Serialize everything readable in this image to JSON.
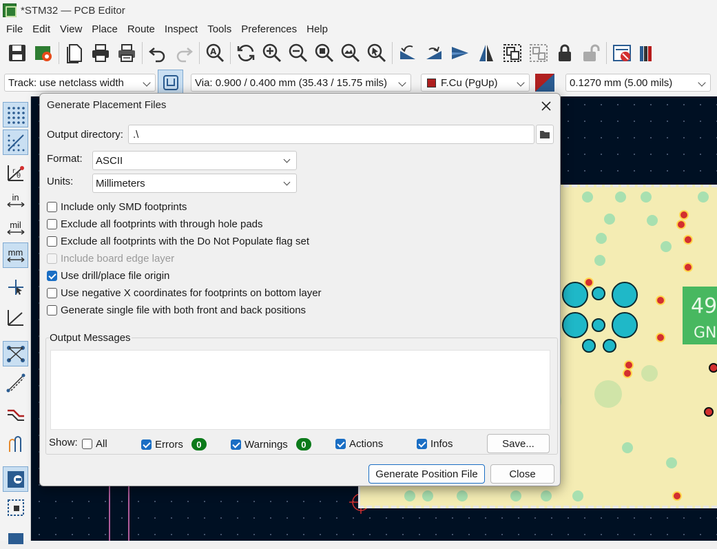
{
  "window": {
    "title": "*STM32 — PCB Editor"
  },
  "menu": [
    "File",
    "Edit",
    "View",
    "Place",
    "Route",
    "Inspect",
    "Tools",
    "Preferences",
    "Help"
  ],
  "toolbar2": {
    "track": "Track: use netclass width",
    "via": "Via: 0.900 / 0.400 mm (35.43 / 15.75 mils)",
    "layer": "F.Cu (PgUp)",
    "layer_color": "#b02020",
    "grid": "0.1270 mm (5.00 mils)"
  },
  "left_toolbar": {
    "in": "in",
    "mil": "mil",
    "mm": "mm"
  },
  "dialog": {
    "title": "Generate Placement Files",
    "output_dir_label": "Output directory:",
    "output_dir_value": ".\\",
    "format_label": "Format:",
    "format_value": "ASCII",
    "units_label": "Units:",
    "units_value": "Millimeters",
    "options": [
      {
        "label": "Include only SMD footprints",
        "checked": false,
        "disabled": false
      },
      {
        "label": "Exclude all footprints with through hole pads",
        "checked": false,
        "disabled": false
      },
      {
        "label": "Exclude all footprints with the Do Not Populate flag set",
        "checked": false,
        "disabled": false
      },
      {
        "label": "Include board edge layer",
        "checked": false,
        "disabled": true
      },
      {
        "label": "Use drill/place file origin",
        "checked": true,
        "disabled": false
      },
      {
        "label": "Use negative X coordinates for footprints on bottom layer",
        "checked": false,
        "disabled": false
      },
      {
        "label": "Generate single file with both front and back positions",
        "checked": false,
        "disabled": false
      }
    ],
    "messages_title": "Output Messages",
    "show_label": "Show:",
    "filters": {
      "all": "All",
      "errors": "Errors",
      "errors_count": "0",
      "warnings": "Warnings",
      "warnings_count": "0",
      "actions": "Actions",
      "infos": "Infos"
    },
    "save_button": "Save...",
    "generate_button": "Generate Position File",
    "close_button": "Close"
  },
  "board_text": {
    "ref_49": "49",
    "gnd": "GN"
  }
}
